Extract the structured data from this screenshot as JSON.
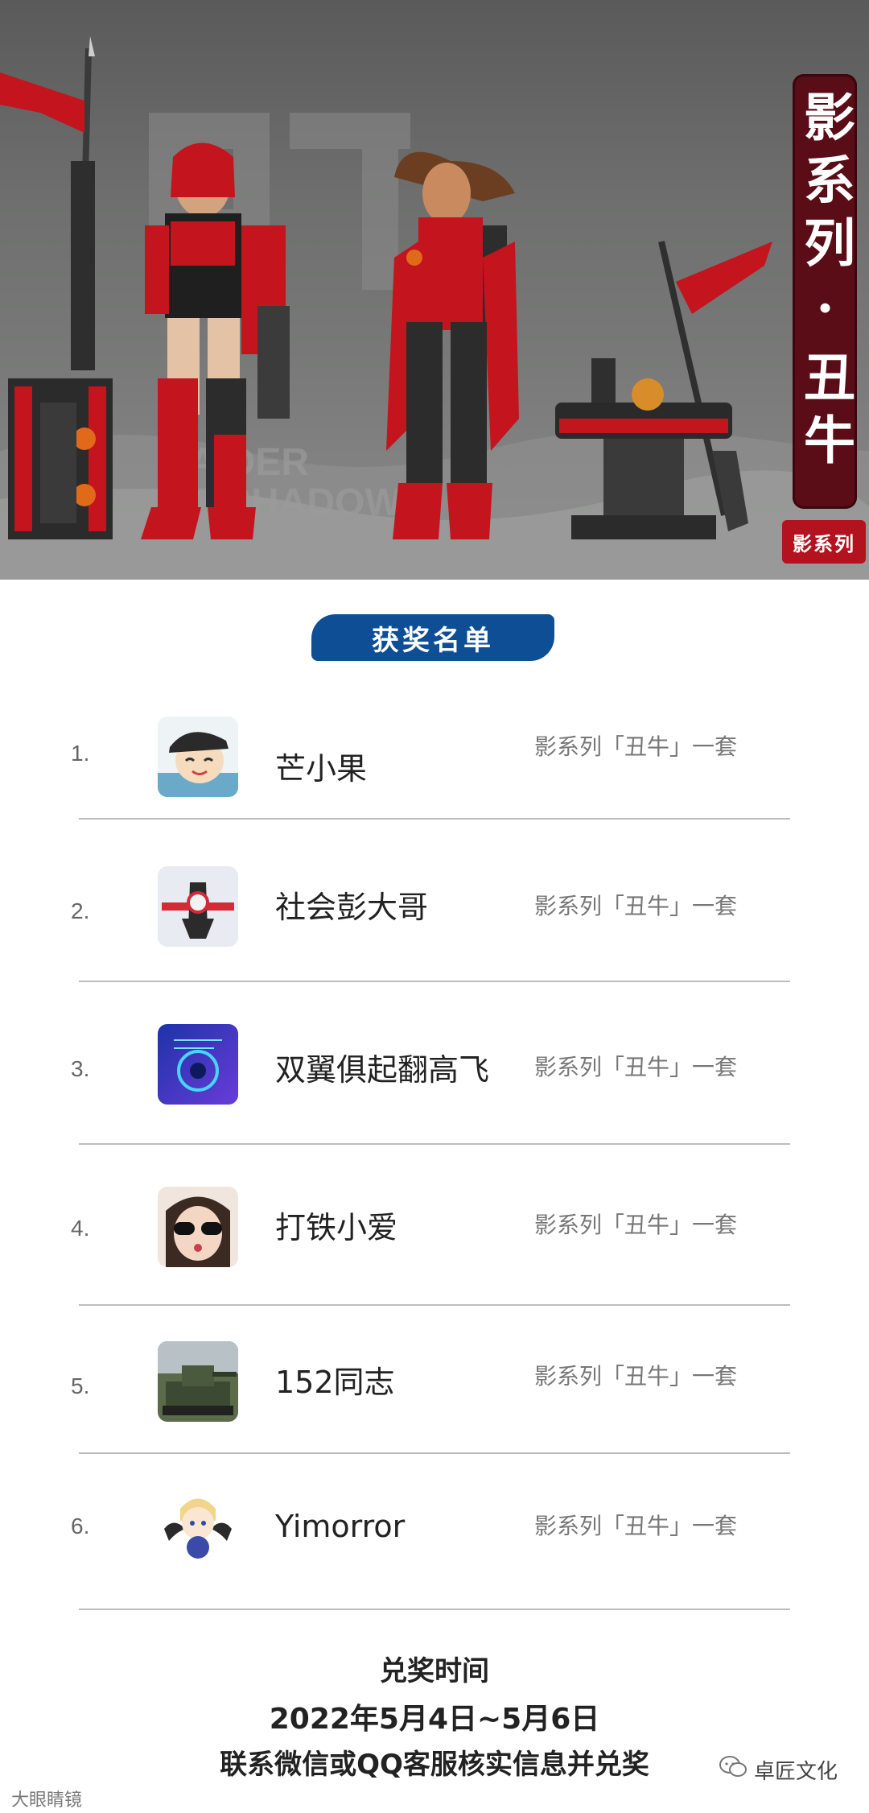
{
  "banner": {
    "title_vertical": "影系列·丑牛",
    "stamp": "影系列",
    "background_letters": "RAIDER OF SHADOW",
    "colors": {
      "panel": "#5a0d16",
      "stamp": "#b3121f",
      "figure_red": "#c4141e"
    }
  },
  "section": {
    "title": "获奖名单"
  },
  "winners": [
    {
      "rank": "1.",
      "name": "芒小果",
      "prize": "影系列「丑牛」一套",
      "avatar_icon": "cartoon-boy-cap-avatar-icon"
    },
    {
      "rank": "2.",
      "name": "社会彭大哥",
      "prize": "影系列「丑牛」一套",
      "avatar_icon": "jet-plane-avatar-icon"
    },
    {
      "rank": "3.",
      "name": "双翼俱起翻高飞",
      "prize": "影系列「丑牛」一套",
      "avatar_icon": "blue-neon-avatar-icon"
    },
    {
      "rank": "4.",
      "name": "打铁小爱",
      "prize": "影系列「丑牛」一套",
      "avatar_icon": "girl-sunglasses-avatar-icon"
    },
    {
      "rank": "5.",
      "name": "152同志",
      "prize": "影系列「丑牛」一套",
      "avatar_icon": "tank-avatar-icon"
    },
    {
      "rank": "6.",
      "name": "Yimorror",
      "prize": "影系列「丑牛」一套",
      "avatar_icon": "anime-wings-avatar-icon"
    }
  ],
  "footer": {
    "redeem_title": "兑奖时间",
    "redeem_dates": "2022年5月4日~5月6日",
    "contact": "联系微信或QQ客服核实信息并兑奖",
    "brand": "卓匠文化",
    "watermark": "大眼睛镜"
  }
}
